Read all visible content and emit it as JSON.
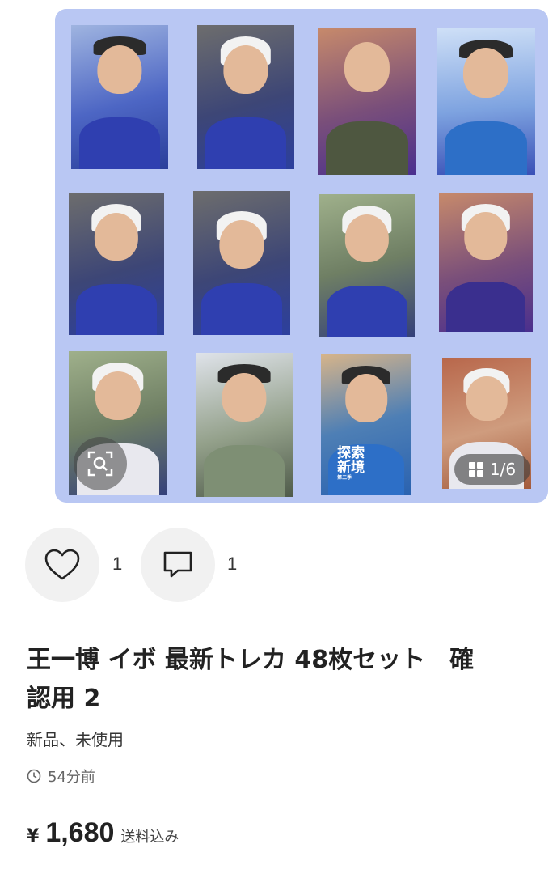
{
  "gallery": {
    "background_color": "#b9c7f3",
    "image_counter": "1/6",
    "search_icon": "image-search-icon",
    "grid_icon": "grid-view-icon",
    "printed_text": {
      "main": "探索\n新境",
      "sub": "第二季"
    }
  },
  "actions": {
    "like_icon": "heart-icon",
    "like_count": "1",
    "comment_icon": "comment-icon",
    "comment_count": "1"
  },
  "listing": {
    "title_line1": "王一博 イボ 最新トレカ 48枚セット　確",
    "title_line2": "認用 2",
    "condition": "新品、未使用",
    "time_icon": "clock-icon",
    "posted": "54分前",
    "currency": "¥",
    "price": "1,680",
    "shipping_note": "送料込み"
  }
}
